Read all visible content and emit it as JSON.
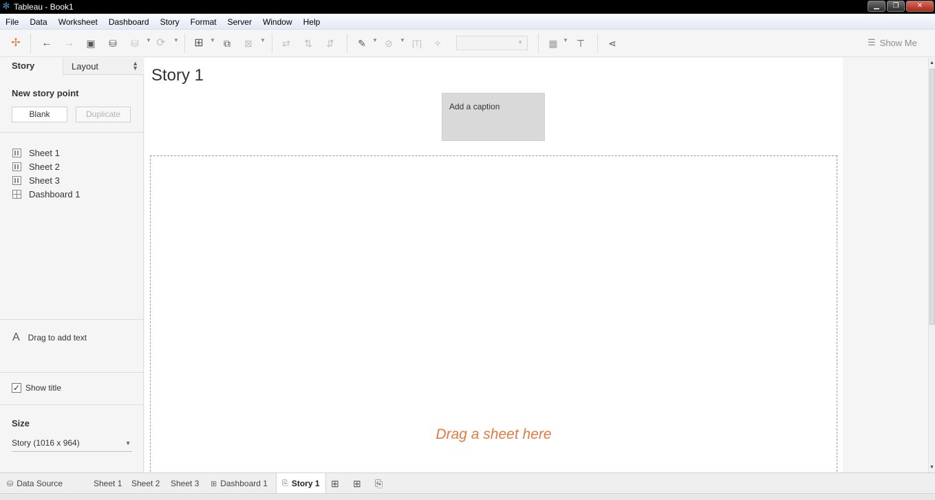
{
  "window": {
    "title": "Tableau - Book1",
    "controls": {
      "minimize": "▁",
      "restore": "❐",
      "close": "✕"
    }
  },
  "menu": [
    "File",
    "Data",
    "Worksheet",
    "Dashboard",
    "Story",
    "Format",
    "Server",
    "Window",
    "Help"
  ],
  "toolbar": {
    "show_me": "Show Me"
  },
  "left_panel": {
    "tabs": {
      "story": "Story",
      "layout": "Layout"
    },
    "new_story_point": {
      "title": "New story point",
      "blank": "Blank",
      "duplicate": "Duplicate"
    },
    "sheets": [
      {
        "label": "Sheet 1",
        "icon": "worksheet-icon"
      },
      {
        "label": "Sheet 2",
        "icon": "worksheet-icon"
      },
      {
        "label": "Sheet 3",
        "icon": "worksheet-icon"
      },
      {
        "label": "Dashboard 1",
        "icon": "dashboard-icon"
      }
    ],
    "drag_text": {
      "glyph": "A",
      "label": "Drag to add text"
    },
    "show_title": {
      "label": "Show title",
      "checked": true,
      "mark": "✓"
    },
    "size": {
      "title": "Size",
      "value": "Story (1016 x 964)"
    }
  },
  "canvas": {
    "story_title": "Story 1",
    "caption": "Add a caption",
    "drop_hint": "Drag a sheet here"
  },
  "bottom_tabs": [
    {
      "label": "Data Source",
      "icon": "database-icon",
      "active": false
    },
    {
      "label": "Sheet 1",
      "icon": "",
      "active": false
    },
    {
      "label": "Sheet 2",
      "icon": "",
      "active": false
    },
    {
      "label": "Sheet 3",
      "icon": "",
      "active": false
    },
    {
      "label": "Dashboard 1",
      "icon": "dashboard-icon",
      "active": false
    },
    {
      "label": "Story 1",
      "icon": "story-icon",
      "active": true
    }
  ],
  "colors": {
    "accent_orange": "#e07a3f",
    "caption_bg": "#d9d9d9",
    "panel_bg": "#f5f5f5"
  }
}
